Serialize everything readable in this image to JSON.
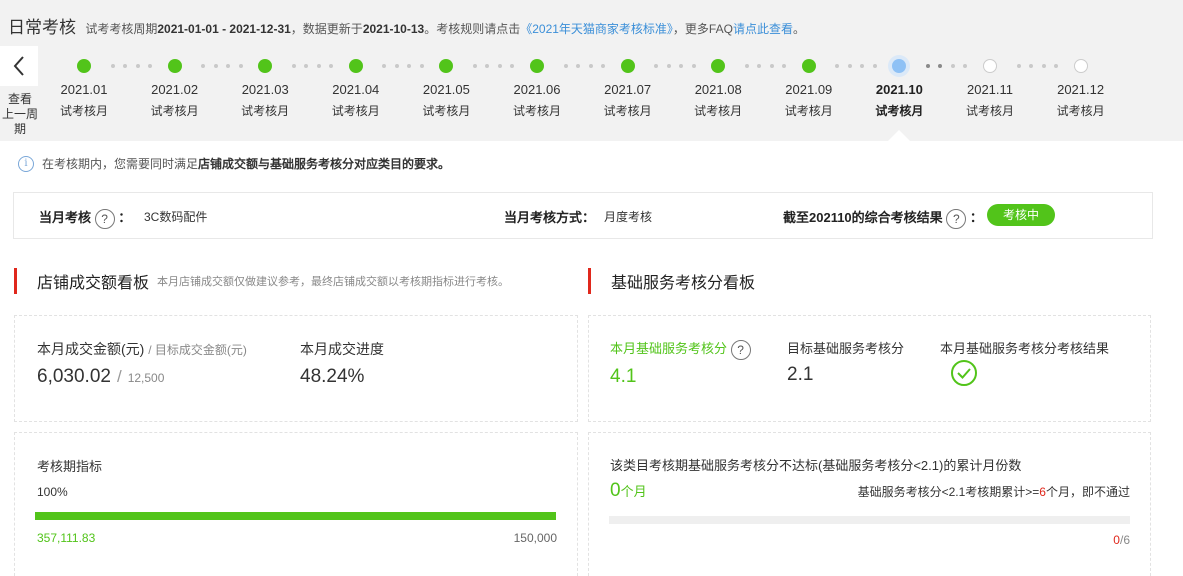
{
  "header": {
    "title": "日常考核",
    "period_prefix": "试考考核周期",
    "period": "2021-01-01 - 2021-12-31",
    "updated_prefix": "，数据更新于",
    "updated": "2021-10-13",
    "rule_prefix": "。考核规则请点击",
    "rule_link": "《2021年天猫商家考核标准》",
    "faq_prefix": "，更多FAQ",
    "faq_link": "请点此查看",
    "faq_suffix": "。"
  },
  "back": {
    "label_1": "查看",
    "label_2": "上一周期"
  },
  "timeline": [
    {
      "month": "2021.01",
      "label": "试考核月",
      "status": "done"
    },
    {
      "month": "2021.02",
      "label": "试考核月",
      "status": "done"
    },
    {
      "month": "2021.03",
      "label": "试考核月",
      "status": "done"
    },
    {
      "month": "2021.04",
      "label": "试考核月",
      "status": "done"
    },
    {
      "month": "2021.05",
      "label": "试考核月",
      "status": "done"
    },
    {
      "month": "2021.06",
      "label": "试考核月",
      "status": "done"
    },
    {
      "month": "2021.07",
      "label": "试考核月",
      "status": "done"
    },
    {
      "month": "2021.08",
      "label": "试考核月",
      "status": "done"
    },
    {
      "month": "2021.09",
      "label": "试考核月",
      "status": "done"
    },
    {
      "month": "2021.10",
      "label": "试考核月",
      "status": "current"
    },
    {
      "month": "2021.11",
      "label": "试考核月",
      "status": "future"
    },
    {
      "month": "2021.12",
      "label": "试考核月",
      "status": "future"
    }
  ],
  "notice": {
    "prefix": "在考核期内，您需要同时满足",
    "bold": "店铺成交额与基础服务考核分对应类目的要求。"
  },
  "summary": {
    "month_label": "当月考核",
    "month_value": "3C数码配件",
    "method_label": "当月考核方式：",
    "method_value": "月度考核",
    "result_label": "截至202110的综合考核结果",
    "result_badge": "考核中"
  },
  "left": {
    "title": "店铺成交额看板",
    "hint": "本月店铺成交额仅做建议参考，最终店铺成交额以考核期指标进行考核。",
    "amount_label": "本月成交金额(元)",
    "target_label": "/ 目标成交金额(元)",
    "amount_value": "6,030.02",
    "target_value": "12,500",
    "progress_label": "本月成交进度",
    "progress_value": "48.24%",
    "indicator_label": "考核期指标",
    "indicator_percent": "100%",
    "indicator_fill": 1.0,
    "indicator_current": "357,111.83",
    "indicator_target": "150,000"
  },
  "right": {
    "title": "基础服务考核分看板",
    "score_label": "本月基础服务考核分",
    "score_value": "4.1",
    "target_label": "目标基础服务考核分",
    "target_value": "2.1",
    "result_label": "本月基础服务考核分考核结果",
    "fail_label": "该类目考核期基础服务考核分不达标(基础服务考核分<2.1)的累计月份数",
    "fail_count": "0",
    "fail_unit": "个月",
    "rule_prefix": "基础服务考核分<2.1考核期累计>=",
    "rule_num": "6",
    "rule_suffix": "个月，即不通过",
    "ratio_num": "0",
    "ratio_den": "/6",
    "ratio_fill": 0
  },
  "colors": {
    "green": "#52c41a",
    "red": "#e0281c",
    "link": "#3b8fd8"
  }
}
